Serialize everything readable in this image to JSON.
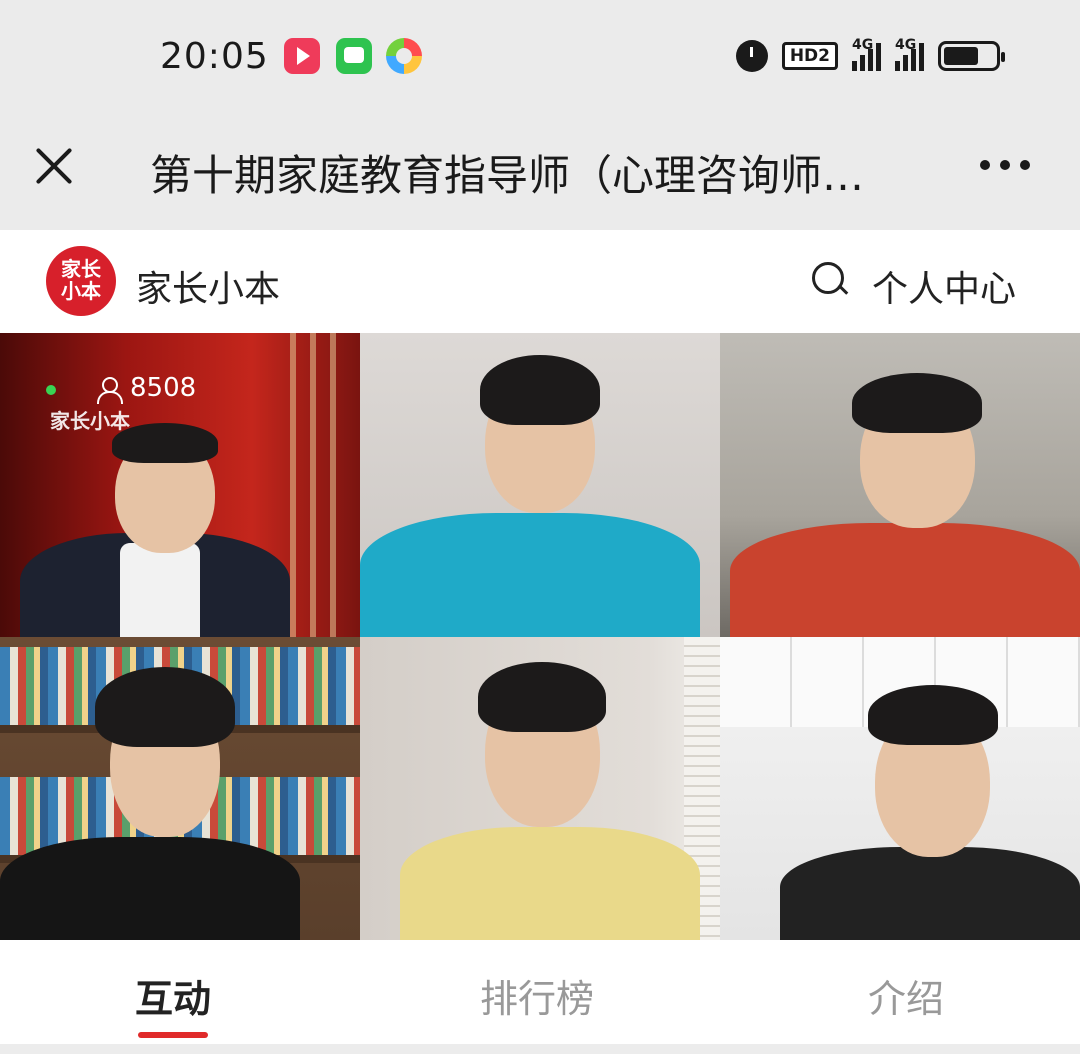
{
  "status_bar": {
    "time": "20:05",
    "hd_label": "HD2",
    "network_1": "4G",
    "network_2": "4G",
    "icons": [
      "video-app-icon",
      "message-app-icon",
      "browser-app-icon",
      "alarm-icon",
      "hd-voice-icon",
      "signal-icon",
      "battery-icon"
    ],
    "battery_level": 0.68
  },
  "title_bar": {
    "title": "第十期家庭教育指导师（心理咨询师…"
  },
  "app_header": {
    "logo_text": "家长小本",
    "brand_name": "家长小本",
    "personal_center": "个人中心"
  },
  "live": {
    "viewer_count": "8508",
    "watermark": "家长小本"
  },
  "tabs": [
    {
      "label": "互动",
      "active": true
    },
    {
      "label": "排行榜",
      "active": false
    },
    {
      "label": "介绍",
      "active": false
    }
  ],
  "colors": {
    "accent_red": "#e02a2a",
    "logo_red": "#d7202b",
    "live_green": "#39d353"
  }
}
